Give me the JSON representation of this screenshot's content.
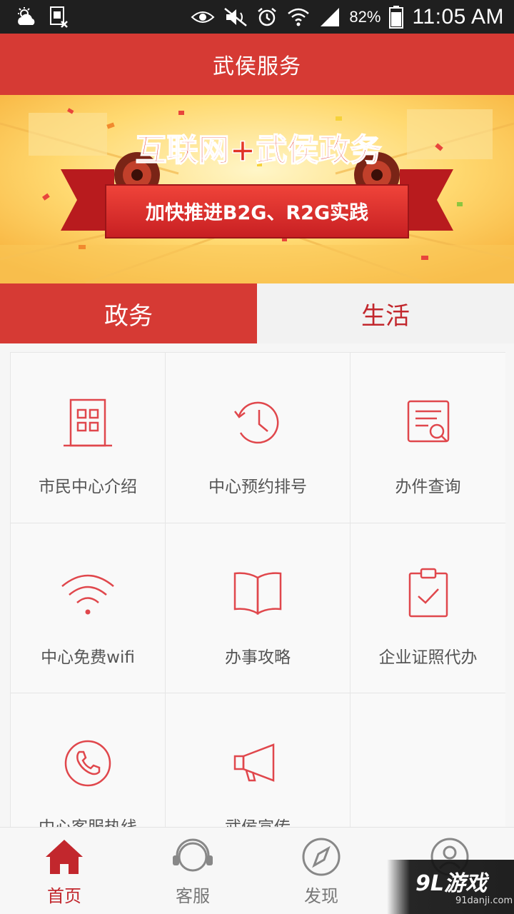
{
  "status_bar": {
    "battery_percent": "82%",
    "time": "11:05 AM",
    "icons": [
      "weather-icon",
      "sim-icon",
      "eye-icon",
      "mute-icon",
      "alarm-icon",
      "wifi-icon",
      "signal-icon",
      "battery-icon"
    ]
  },
  "header": {
    "title": "武侯服务"
  },
  "banner": {
    "headline": "互联网+武侯政务",
    "ribbon": "加快推进B2G、R2G实践"
  },
  "tabs": [
    {
      "label": "政务",
      "active": true
    },
    {
      "label": "生活",
      "active": false
    }
  ],
  "services": [
    {
      "label": "市民中心介绍",
      "icon": "building-icon"
    },
    {
      "label": "中心预约排号",
      "icon": "clock-history-icon"
    },
    {
      "label": "办件查询",
      "icon": "document-search-icon"
    },
    {
      "label": "中心免费wifi",
      "icon": "wifi-icon"
    },
    {
      "label": "办事攻略",
      "icon": "book-icon"
    },
    {
      "label": "企业证照代办",
      "icon": "clipboard-check-icon"
    },
    {
      "label": "中心客服热线",
      "icon": "phone-icon"
    },
    {
      "label": "武侯宣传",
      "icon": "megaphone-icon"
    }
  ],
  "bottom_nav": [
    {
      "label": "首页",
      "icon": "home-icon",
      "active": true
    },
    {
      "label": "客服",
      "icon": "headset-icon",
      "active": false
    },
    {
      "label": "发现",
      "icon": "compass-icon",
      "active": false
    },
    {
      "label": "",
      "icon": "user-icon",
      "active": false
    }
  ],
  "watermark": {
    "main": "9L游戏",
    "sub": "91danji.com"
  },
  "colors": {
    "brand_red": "#d63a34",
    "icon_red": "#e0474c",
    "tab_text_red": "#c2272d"
  }
}
